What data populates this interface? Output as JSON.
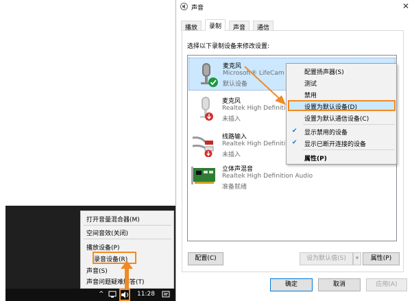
{
  "dialog": {
    "title": "声音",
    "tabs": [
      {
        "label": "播放"
      },
      {
        "label": "录制"
      },
      {
        "label": "声音"
      },
      {
        "label": "通信"
      }
    ],
    "instruction": "选择以下录制设备来修改设置:",
    "devices": [
      {
        "name": "麦克风",
        "detail": "Microsoft® LifeCam C",
        "status": "默认设备"
      },
      {
        "name": "麦克风",
        "detail": "Realtek High Definition",
        "status": "未插入"
      },
      {
        "name": "线路输入",
        "detail": "Realtek High Definition",
        "status": "未插入"
      },
      {
        "name": "立体声混音",
        "detail": "Realtek High Definition Audio",
        "status": "准备就绪"
      }
    ],
    "buttons": {
      "configure": "配置(C)",
      "set_default": "设为默认值(S)",
      "properties": "属性(P)",
      "ok": "确定",
      "cancel": "取消",
      "apply": "应用(A)"
    }
  },
  "context_menu": {
    "items": [
      {
        "label": "配置扬声器(S)"
      },
      {
        "label": "测试"
      },
      {
        "label": "禁用"
      },
      {
        "label": "设置为默认设备(D)"
      },
      {
        "label": "设置为默认通信设备(C)"
      },
      {
        "label": "显示禁用的设备"
      },
      {
        "label": "显示已断开连接的设备"
      },
      {
        "label": "属性(P)"
      }
    ]
  },
  "tray_menu": {
    "items": [
      {
        "label": "打开音量混合器(M)"
      },
      {
        "label": "空间音效(关闭)"
      },
      {
        "label": "播放设备(P)"
      },
      {
        "label": "录音设备(R)"
      },
      {
        "label": "声音(S)"
      },
      {
        "label": "声音问题疑难解答(T)"
      }
    ]
  },
  "taskbar": {
    "time": "11:28"
  },
  "colors": {
    "highlight": "#cce8ff",
    "accent_orange": "#f08a24",
    "check_blue": "#0078d7",
    "default_green": "#1a9a3c",
    "unplugged_red": "#d32f2f"
  }
}
